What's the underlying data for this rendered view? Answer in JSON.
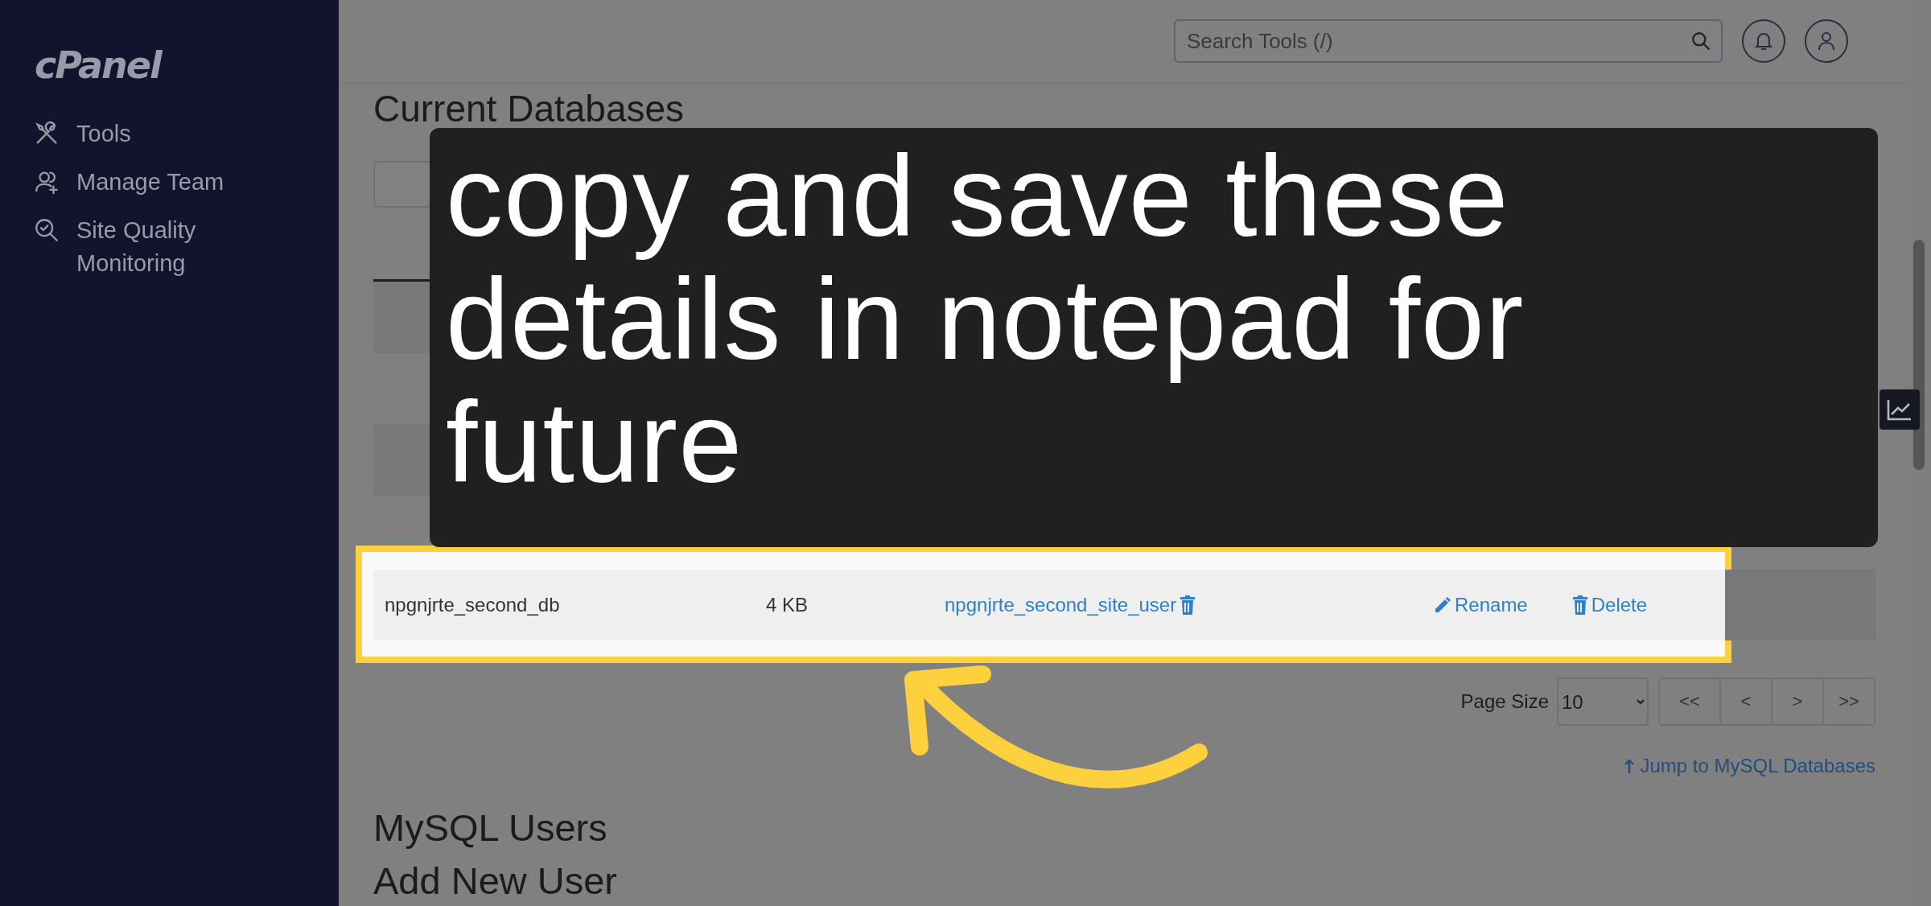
{
  "sidebar": {
    "logo": "cPanel",
    "items": [
      {
        "label": "Tools"
      },
      {
        "label": "Manage Team"
      },
      {
        "label": "Site Quality Monitoring"
      }
    ]
  },
  "header": {
    "search": {
      "placeholder": "Search Tools (/)"
    }
  },
  "section": {
    "title": "Current Databases",
    "highlighted_row": {
      "database": "npgnjrte_second_db",
      "size": "4 KB",
      "users": [
        "npgnjrte_second_site_user"
      ],
      "actions": [
        {
          "kind": "rename",
          "label": "Rename"
        },
        {
          "kind": "delete",
          "label": "Delete"
        }
      ]
    },
    "page_size": {
      "label": "Page Size",
      "value": "10"
    },
    "pager": [
      "<<",
      "<",
      ">",
      ">>"
    ],
    "jump_link": "Jump to MySQL Databases"
  },
  "headings": [
    "MySQL Users",
    "Add New User"
  ],
  "caption": "copy and save these details in notepad for future"
}
